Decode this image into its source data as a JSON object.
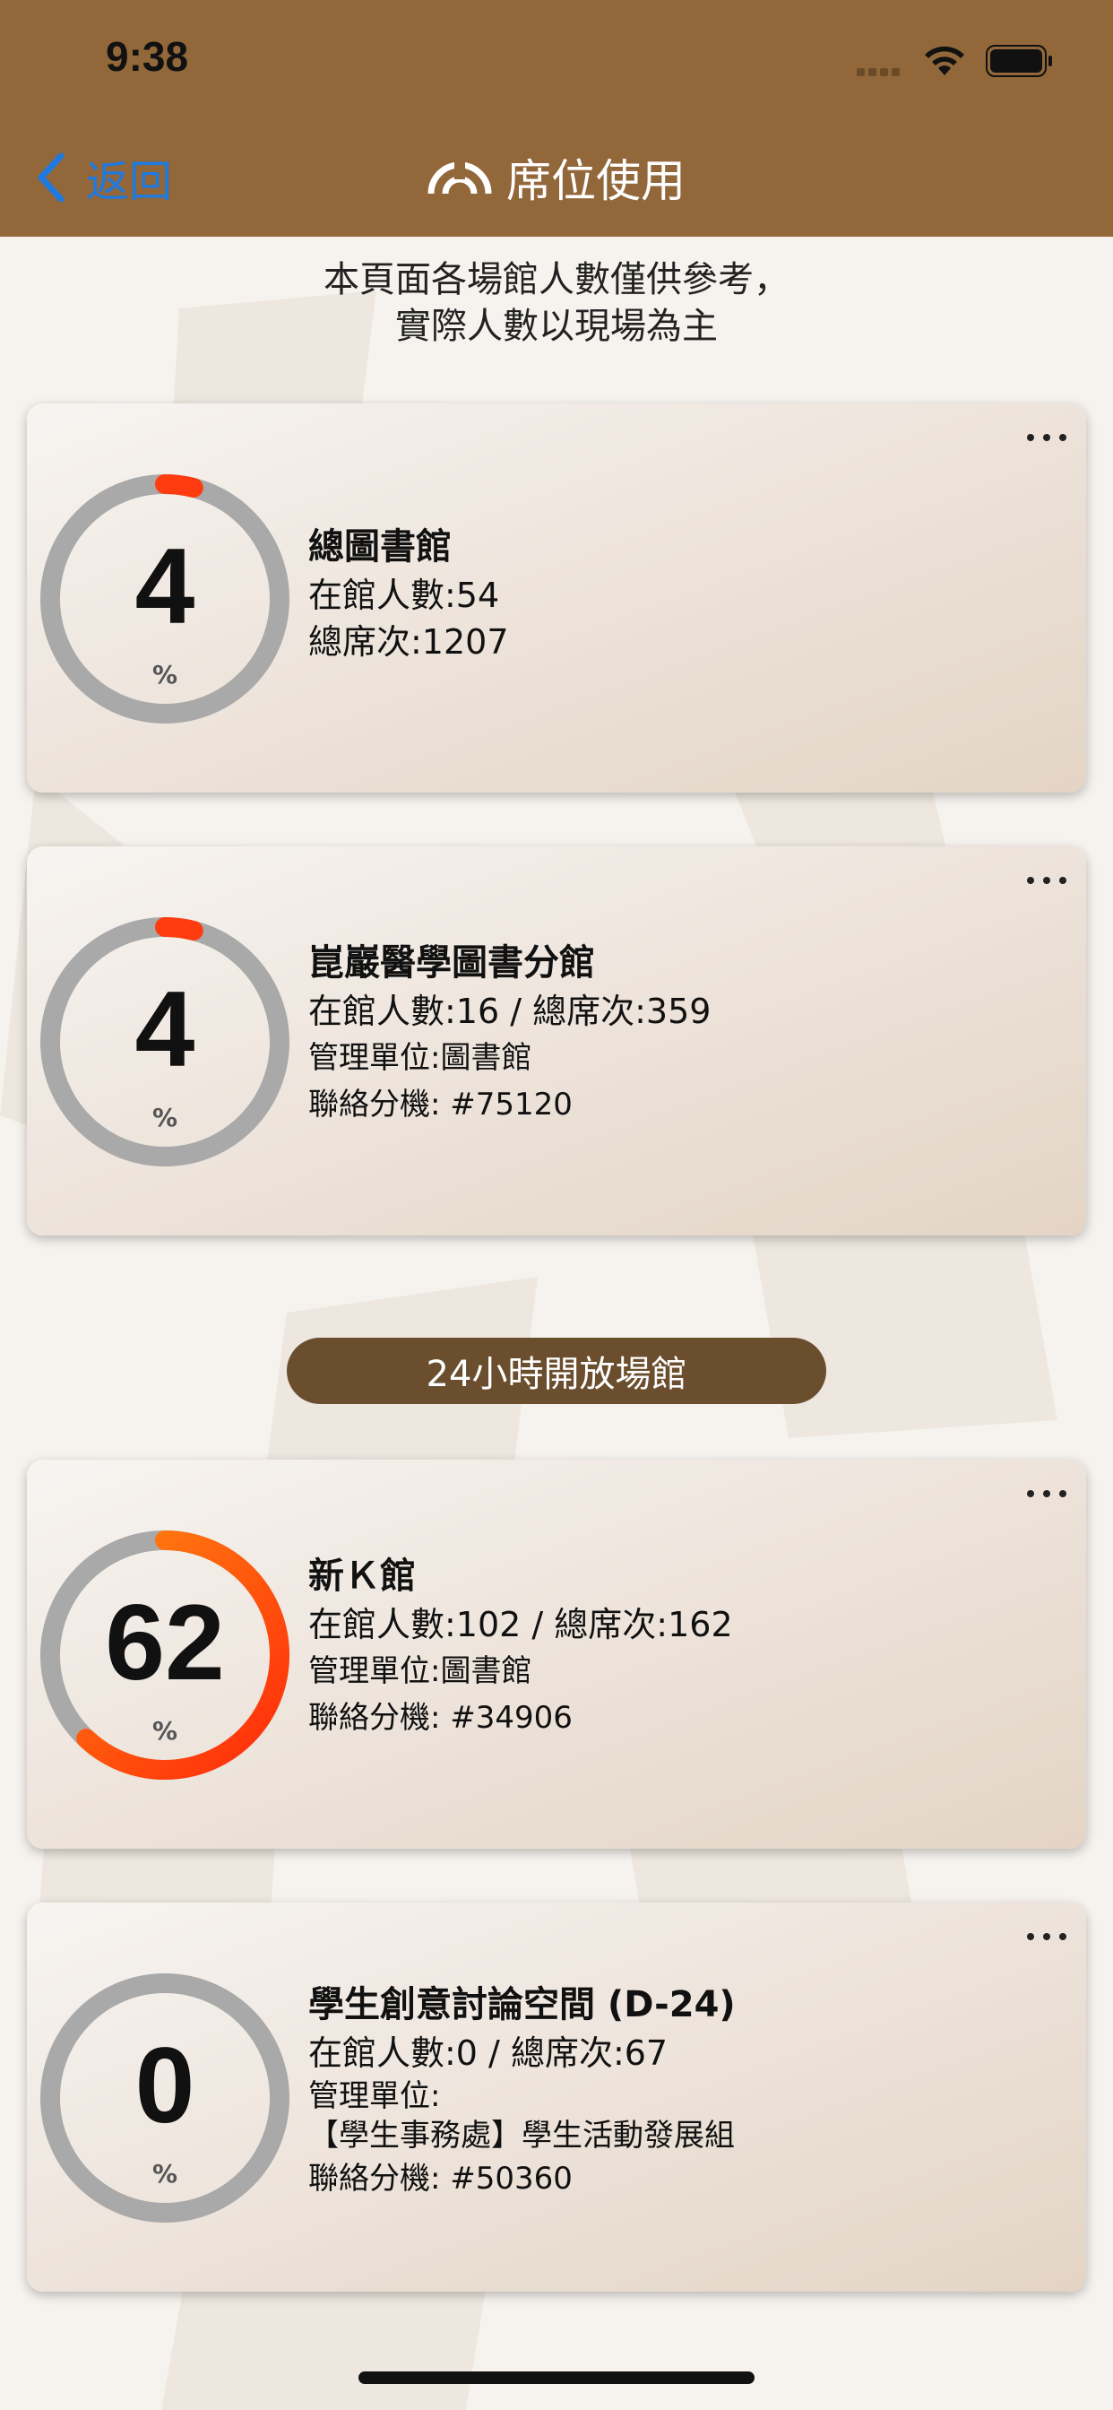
{
  "status_bar": {
    "time": "9:38"
  },
  "nav": {
    "back_label": "返回",
    "title": "席位使用"
  },
  "notice": {
    "line1": "本頁面各場館人數僅供參考，",
    "line2": "實際人數以現場為主"
  },
  "section": {
    "label": "24小時開放場館"
  },
  "colors": {
    "header": "#92673a",
    "accent_link": "#1f7ae0",
    "gauge_track": "#a9a9a9",
    "gauge_fill": "#ff3c0f",
    "pill": "#6a4e2e"
  },
  "venues": [
    {
      "name": "總圖書館",
      "percent_value": 4,
      "percent_text": "4",
      "pct_symbol": "%",
      "line1": "在館人數:54",
      "line2": "總席次:1207"
    },
    {
      "name": "崑巖醫學圖書分館",
      "percent_value": 4,
      "percent_text": "4",
      "pct_symbol": "%",
      "line1": "在館人數:16 / 總席次:359",
      "line2": "管理單位:圖書館",
      "line3": "聯絡分機: #75120"
    },
    {
      "name": "新Ｋ館",
      "percent_value": 62,
      "percent_text": "62",
      "pct_symbol": "%",
      "line1": "在館人數:102 / 總席次:162",
      "line2": "管理單位:圖書館",
      "line3": "聯絡分機: #34906"
    },
    {
      "name": "學生創意討論空間 (D-24)",
      "percent_value": 0,
      "percent_text": "0",
      "pct_symbol": "%",
      "line1": "在館人數:0 / 總席次:67",
      "line2": "管理單位:",
      "line3": "【學生事務處】學生活動發展組",
      "line4": "聯絡分機: #50360"
    }
  ]
}
